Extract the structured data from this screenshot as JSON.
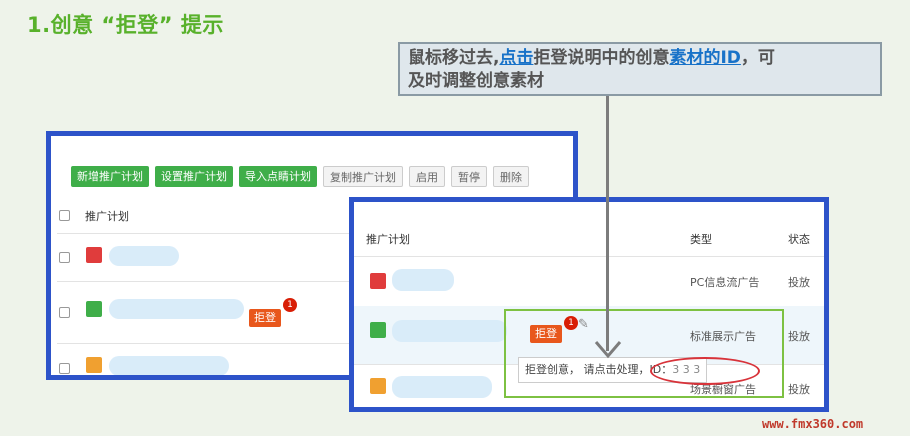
{
  "title": "1.创意 “拒登” 提示",
  "callout": {
    "prefix": "鼠标移过去,",
    "click": "点击",
    "middle": "拒登说明中的创意",
    "material_id": "素材的ID",
    "suffix": "，可",
    "line2": "及时调整创意素材"
  },
  "toolbar": {
    "new_plan": "新增推广计划",
    "set_plan": "设置推广计划",
    "import_plan": "导入点睛计划",
    "copy_plan": "复制推广计划",
    "enable": "启用",
    "pause": "暂停",
    "delete": "删除"
  },
  "back_table": {
    "header": "推广计划",
    "badge_label": "拒登",
    "badge_count": "1"
  },
  "front_table": {
    "headers": {
      "plan": "推广计划",
      "type": "类型",
      "status": "状态"
    },
    "rows": [
      {
        "type": "PC信息流广告",
        "status": "投放"
      },
      {
        "type": "标准展示广告",
        "status": "投放"
      },
      {
        "type": "场景橱窗广告",
        "status": "投放"
      }
    ],
    "badge_label": "拒登",
    "badge_count": "1",
    "tooltip_text": "拒登创意， 请点击处理，",
    "tooltip_id_label": "ID：",
    "tooltip_id_value": "3 3 3"
  },
  "colors": {
    "accent_green": "#58b12b",
    "frame_blue": "#2d53c9",
    "badge_orange": "#e8571c",
    "highlight_red": "#d8333a"
  },
  "icons": {
    "plan_table": "table-icon",
    "plan_monitor": "monitor-icon",
    "plan_mail": "mail-icon",
    "pencil": "pencil-icon"
  },
  "watermark": "www.fmx360.com"
}
